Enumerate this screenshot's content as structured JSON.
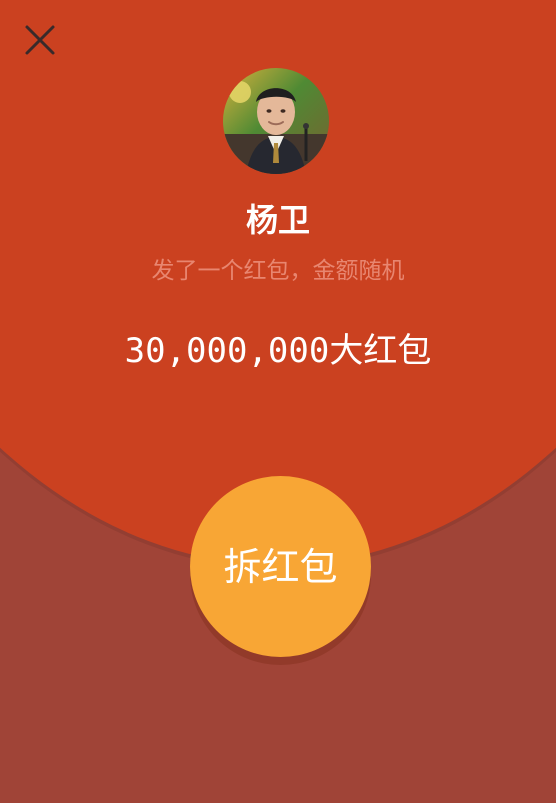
{
  "red_packet": {
    "sender_name": "杨卫",
    "message": "发了一个红包，金额随机",
    "amount_text": "30,000,000大红包",
    "open_button_label": "拆红包"
  },
  "icons": {
    "close": "close-icon",
    "avatar": "avatar-image"
  },
  "colors": {
    "top_background": "#cb4120",
    "bottom_background": "#a04437",
    "button_background": "#f8a635",
    "subtitle_text": "#e88670",
    "text_white": "#ffffff"
  }
}
